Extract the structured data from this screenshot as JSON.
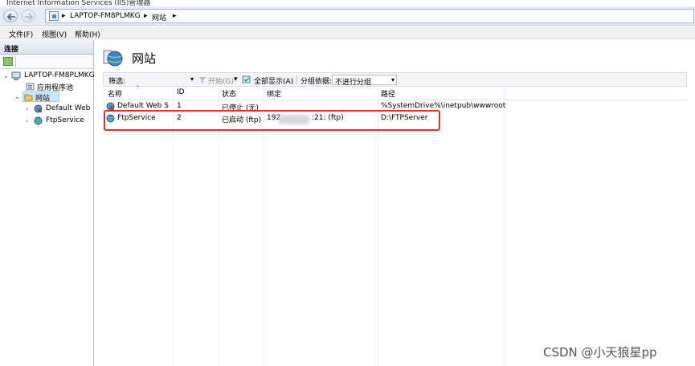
{
  "window": {
    "title": "Internet Information Services (IIS)管理器"
  },
  "address": {
    "segments": [
      "LAPTOP-FM8PLMKG",
      "网站"
    ]
  },
  "menu": {
    "file": "文件(F)",
    "view": "视图(V)",
    "help": "帮助(H)"
  },
  "connections": {
    "title": "连接",
    "tree": {
      "server": "LAPTOP-FM8PLMKG",
      "app_pools": "应用程序池",
      "sites": "网站",
      "site_default": "Default Web S",
      "site_ftp": "FtpService"
    }
  },
  "page": {
    "title": "网站",
    "filter": {
      "label": "筛选:",
      "start": "开始(G)",
      "show_all": "全部显示(A)",
      "group_by_label": "分组依据:",
      "group_by_value": "不进行分组"
    },
    "columns": [
      "名称",
      "ID",
      "状态",
      "绑定",
      "路径"
    ],
    "rows": [
      {
        "name": "Default Web S",
        "id": "1",
        "status": "已停止 (无)",
        "binding": "",
        "path": "%SystemDrive%\\inetpub\\wwwroot"
      },
      {
        "name": "FtpService",
        "id": "2",
        "status": "已启动 (ftp)",
        "binding_prefix": "192.",
        "binding_suffix": ":21: (ftp)",
        "path": "D:\\FTPServer"
      }
    ]
  },
  "watermark": "CSDN @小天狼星pp",
  "colors": {
    "highlight": "#e52e2e",
    "selection": "#cce8ff"
  }
}
